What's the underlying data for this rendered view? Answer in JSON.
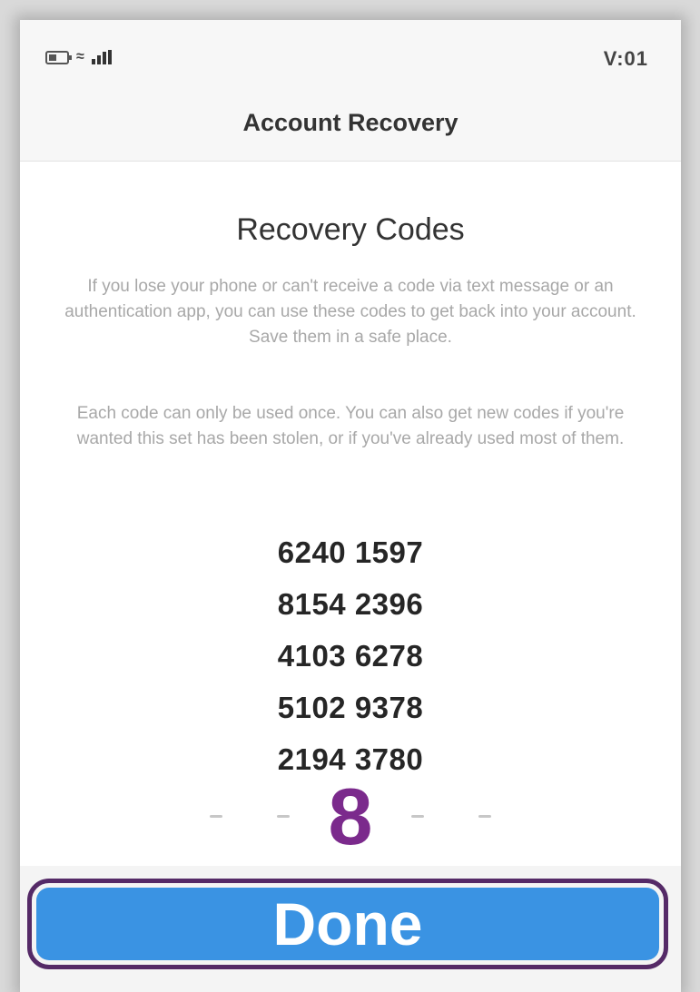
{
  "status_bar": {
    "time": "V:01"
  },
  "nav": {
    "title": "Account Recovery"
  },
  "content": {
    "heading": "Recovery Codes",
    "paragraph_1": "If you lose your phone or can't receive a code via text message or an authentication app, you can use these codes to get back into your account. Save them in a safe place.",
    "paragraph_2": "Each code can only be used once. You can also get new codes if you're wanted this set has been stolen, or if you've already used most of them.",
    "codes": [
      "6240 1597",
      "8154 2396",
      "4103 6278",
      "5102 9378",
      "2194 3780"
    ]
  },
  "annotation": {
    "step_number": "8",
    "color": "#7b2a8c"
  },
  "footer": {
    "done_label": "Done",
    "button_color": "#3a93e3",
    "outline_color": "#552a67"
  }
}
